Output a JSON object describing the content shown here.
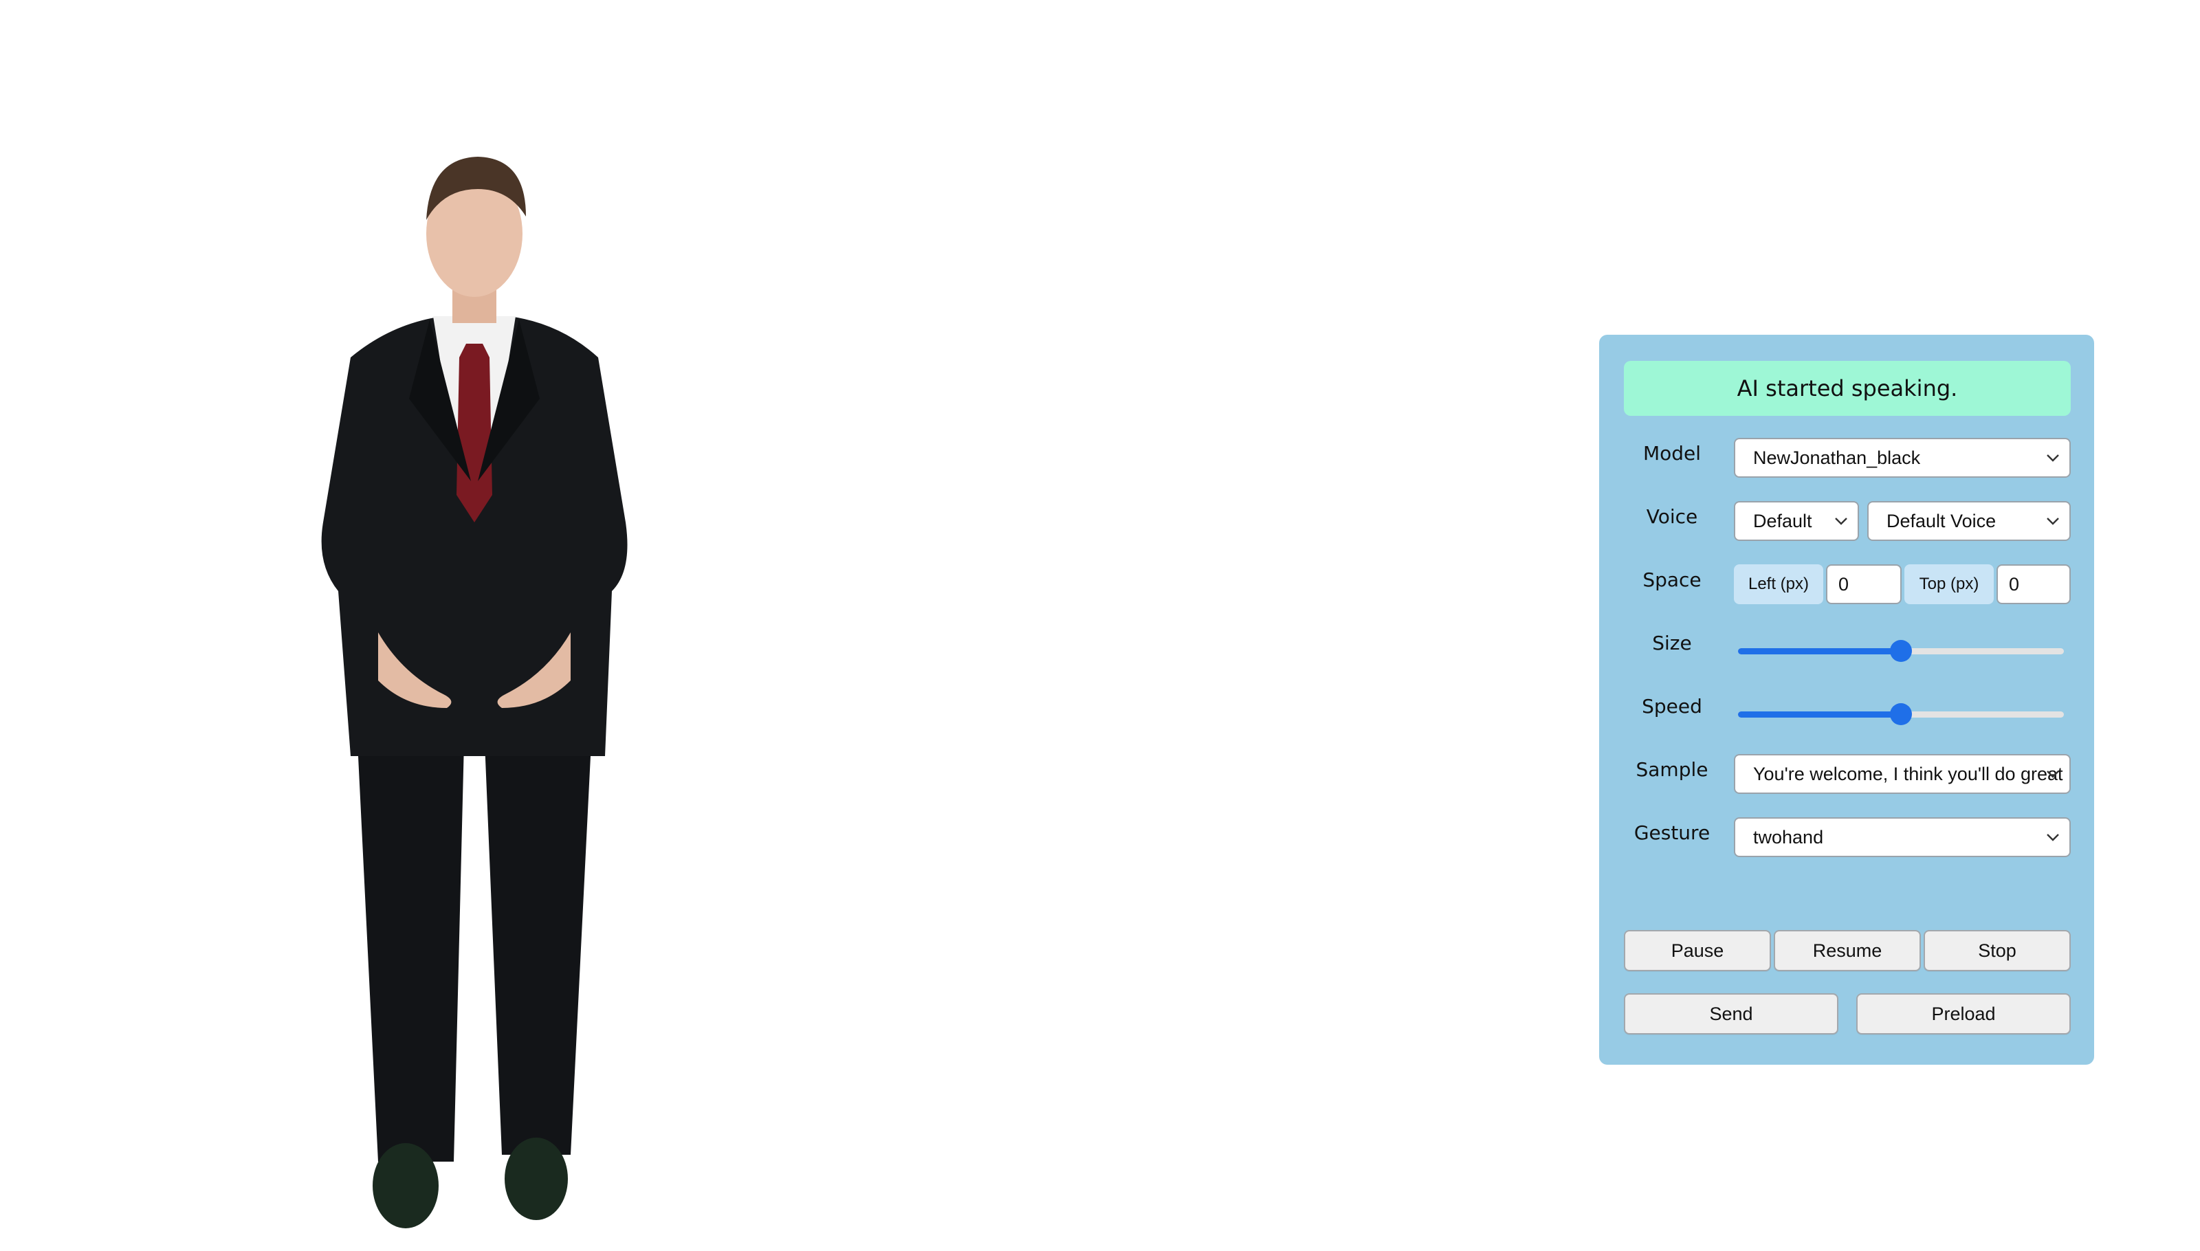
{
  "colors": {
    "panel_bg": "#97cbe5",
    "status_bg": "#9ef7d6",
    "slider_accent": "#1f6fe8",
    "tag_bg": "#c9e4f6"
  },
  "avatar": {
    "description_icon": "person-avatar-icon"
  },
  "panel": {
    "status": "AI started speaking.",
    "model": {
      "label": "Model",
      "value": "NewJonathan_black"
    },
    "voice": {
      "label": "Voice",
      "engine": "Default",
      "voice": "Default Voice"
    },
    "space": {
      "label": "Space",
      "left_label": "Left (px)",
      "left_value": "0",
      "top_label": "Top (px)",
      "top_value": "0"
    },
    "size": {
      "label": "Size",
      "level": 0.5
    },
    "speed": {
      "label": "Speed",
      "level": 0.5
    },
    "sample": {
      "label": "Sample",
      "value": "You're welcome, I think you'll do great"
    },
    "gesture": {
      "label": "Gesture",
      "value": "twohand"
    },
    "buttons": {
      "pause": "Pause",
      "resume": "Resume",
      "stop": "Stop",
      "send": "Send",
      "preload": "Preload"
    }
  }
}
